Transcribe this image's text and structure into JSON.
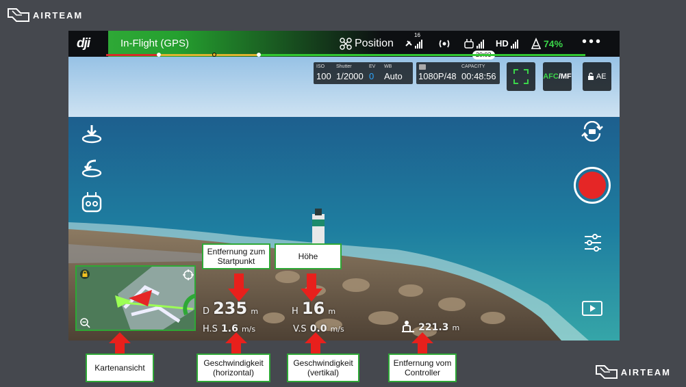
{
  "brand": {
    "name": "AIRTEAM"
  },
  "topbar": {
    "app_logo": "dji",
    "flight_status": "In-Flight (GPS)",
    "mode": "Position",
    "gps_count": "16",
    "hd_label": "HD",
    "battery": "74%",
    "more": "•••",
    "time_badge": "20:03"
  },
  "camera": {
    "iso_label": "ISO",
    "iso": "100",
    "shutter_label": "Shutter",
    "shutter": "1/2000",
    "ev_label": "EV",
    "ev": "0",
    "wb_label": "WB",
    "wb": "Auto",
    "resolution": "1080P/48",
    "capacity_label": "CAPACITY",
    "capacity": "00:48:56",
    "afc": "AFC",
    "mf": "/MF",
    "ae": "AE"
  },
  "telemetry": {
    "d_label": "D",
    "d_value": "235",
    "d_unit": "m",
    "h_label": "H",
    "h_value": "16",
    "h_unit": "m",
    "hs_label": "H.S",
    "hs_value": "1.6",
    "hs_unit": "m/s",
    "vs_label": "V.S",
    "vs_value": "0.0",
    "vs_unit": "m/s",
    "rc_value": "221.3",
    "rc_unit": "m"
  },
  "callouts": {
    "home_distance": "Entfernung zum Startpunkt",
    "height": "Höhe",
    "map_view": "Kartenansicht",
    "h_speed": "Geschwindigkeit (horizontal)",
    "v_speed": "Geschwindigkeit (vertikal)",
    "controller_distance": "Entfernung vom Controller"
  },
  "colors": {
    "accent_green": "#2ea836",
    "record_red": "#e52626",
    "arrow_red": "#e8201c"
  }
}
